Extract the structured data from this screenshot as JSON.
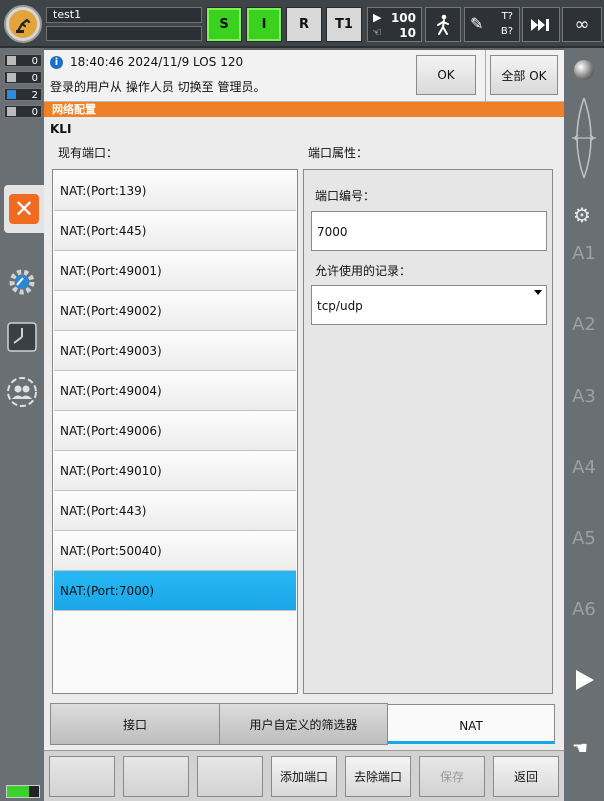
{
  "topbar": {
    "title": "test1",
    "modes": [
      {
        "label": "S",
        "active": true
      },
      {
        "label": "I",
        "active": true
      },
      {
        "label": "R",
        "active": false
      },
      {
        "label": "T1",
        "active": false
      }
    ],
    "override_program": "100",
    "override_jog": "10",
    "tool_status_t": "T?",
    "tool_status_b": "B?",
    "increment": "∞"
  },
  "left_status": [
    {
      "value": "0"
    },
    {
      "value": "0"
    },
    {
      "value": "2"
    },
    {
      "value": "0"
    }
  ],
  "message": {
    "time": "18:40:46 2024/11/9 LOS 120",
    "text": "登录的用户从 操作人员 切换至 管理员。",
    "ok_label": "OK",
    "ok_all_label": "全部 OK"
  },
  "window": {
    "header": "网络配置",
    "section": "KLI",
    "ports_label": "现有端口：",
    "props_label": "端口属性："
  },
  "ports": [
    "NAT:(Port:139)",
    "NAT:(Port:445)",
    "NAT:(Port:49001)",
    "NAT:(Port:49002)",
    "NAT:(Port:49003)",
    "NAT:(Port:49004)",
    "NAT:(Port:49006)",
    "NAT:(Port:49010)",
    "NAT:(Port:443)",
    "NAT:(Port:50040)",
    "NAT:(Port:7000)"
  ],
  "selected_port_index": 10,
  "properties": {
    "port_number_label": "端口编号：",
    "port_number_value": "7000",
    "allowed_label": "允许使用的记录：",
    "allowed_value": "tcp/udp"
  },
  "tabs": [
    "接口",
    "用户自定义的筛选器",
    "NAT"
  ],
  "active_tab": 2,
  "toolbar": {
    "add_port": "添加端口",
    "remove_port": "去除端口",
    "save": "保存",
    "back": "返回"
  },
  "right_rail": {
    "axes": [
      "A1",
      "A2",
      "A3",
      "A4",
      "A5",
      "A6"
    ]
  },
  "colors": {
    "accent_orange": "#f08027",
    "selection_blue": "#1aa6e8",
    "mode_green": "#3ad11f"
  }
}
